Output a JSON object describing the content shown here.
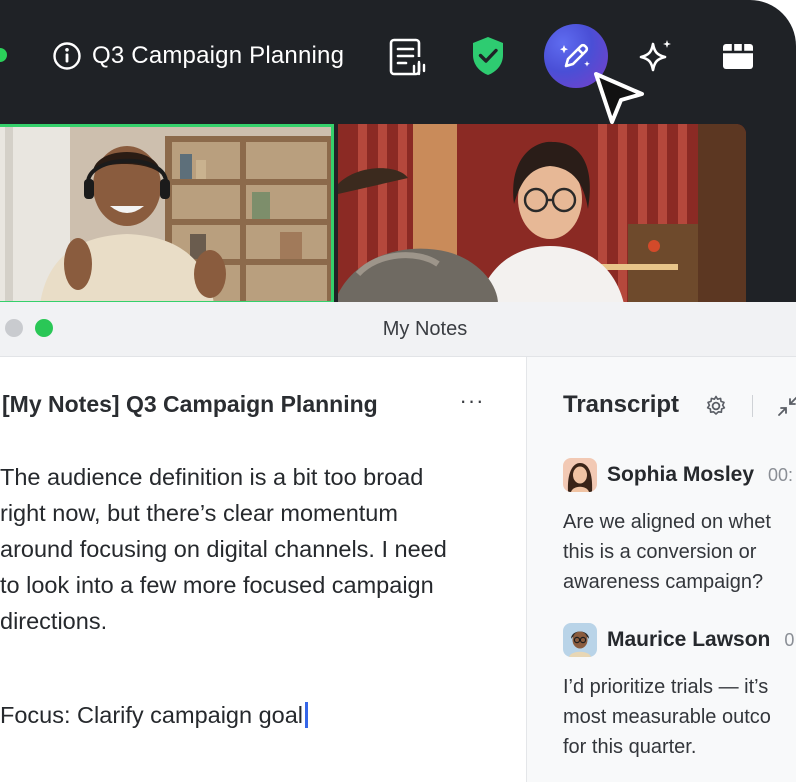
{
  "toolbar": {
    "meeting_title": "Q3 Campaign Planning",
    "buttons": [
      {
        "name": "notes-icon",
        "label": "Notes"
      },
      {
        "name": "shield-check-icon",
        "label": "Security"
      },
      {
        "name": "ai-pen-icon",
        "label": "AI notes"
      },
      {
        "name": "sparkle-icon",
        "label": "AI companion"
      },
      {
        "name": "grid-icon",
        "label": "Apps"
      }
    ],
    "accent": "#4a4fd6",
    "shield_color": "#2ecc71"
  },
  "notes_window": {
    "title": "My Notes",
    "doc_title": "[My Notes] Q3 Campaign Planning",
    "more_label": "···",
    "body": "The audience definition is a bit too broad\nright now, but there’s clear momentum\naround focusing on digital channels. I need\nto look into a few more focused campaign\ndirections.",
    "focus_line": "Focus: Clarify campaign goal"
  },
  "transcript": {
    "title": "Transcript",
    "entries": [
      {
        "speaker": "Sophia Mosley",
        "time": "00:",
        "text": "Are we aligned on whet\nthis is a conversion or\nawareness campaign?"
      },
      {
        "speaker": "Maurice Lawson",
        "time": "0",
        "text": "I’d prioritize trials — it’s\nmost measurable outco\nfor this quarter."
      }
    ]
  }
}
